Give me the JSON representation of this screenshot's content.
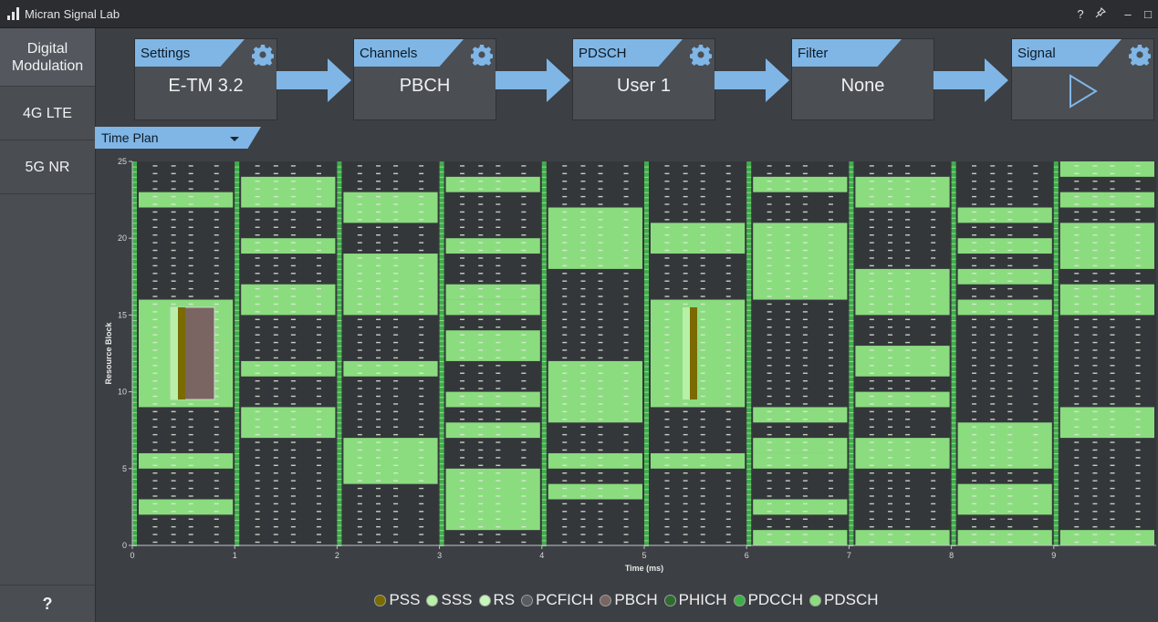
{
  "window": {
    "title": "Micran Signal Lab",
    "controls": {
      "help": "?",
      "pin": "pin-icon",
      "minimize": "–",
      "maximize": "□"
    }
  },
  "sidebar": {
    "items": [
      {
        "label": "Digital\nModulation",
        "active": true
      },
      {
        "label": "4G LTE",
        "active": false
      },
      {
        "label": "5G NR",
        "active": false
      }
    ],
    "help": "?"
  },
  "pipeline": {
    "settings": {
      "label": "Settings",
      "value": "E-TM 3.2"
    },
    "channels": {
      "label": "Channels",
      "value": "PBCH"
    },
    "pdsch": {
      "label": "PDSCH",
      "value": "User 1"
    },
    "filter": {
      "label": "Filter",
      "value": "None"
    },
    "signal": {
      "label": "Signal",
      "icon": "play-icon"
    }
  },
  "timeplan": {
    "dropdown_label": "Time Plan"
  },
  "colors": {
    "accent": "#7fb6e6",
    "PSS": "#7a6a00",
    "SSS": "#b8f0a8",
    "RS": "#c8f5bc",
    "PCFICH": "#5a5c60",
    "PBCH": "#7a6562",
    "PHICH": "#2f6a2e",
    "PDCCH": "#3fae4a",
    "PDSCH": "#8bdc7f"
  },
  "chart_data": {
    "type": "heatmap",
    "xlabel": "Time (ms)",
    "ylabel": "Resource Block",
    "xlim": [
      0,
      10
    ],
    "ylim": [
      0,
      25
    ],
    "x_ticks": [
      "0",
      "1",
      "2",
      "3",
      "4",
      "5",
      "6",
      "7",
      "8",
      "9"
    ],
    "y_ticks": [
      "0",
      "5",
      "10",
      "15",
      "20",
      "25"
    ],
    "pdsch_allocations": [
      {
        "subframe": 0,
        "rb_ranges": [
          [
            2,
            3
          ],
          [
            5,
            6
          ],
          [
            9,
            16
          ],
          [
            22,
            23
          ]
        ]
      },
      {
        "subframe": 1,
        "rb_ranges": [
          [
            7,
            9
          ],
          [
            11,
            12
          ],
          [
            15,
            17
          ],
          [
            19,
            20
          ],
          [
            22,
            24
          ]
        ]
      },
      {
        "subframe": 2,
        "rb_ranges": [
          [
            4,
            7
          ],
          [
            11,
            12
          ],
          [
            15,
            19
          ],
          [
            21,
            23
          ]
        ]
      },
      {
        "subframe": 3,
        "rb_ranges": [
          [
            1,
            5
          ],
          [
            7,
            8
          ],
          [
            9,
            10
          ],
          [
            12,
            14
          ],
          [
            15,
            16
          ],
          [
            16,
            17
          ],
          [
            19,
            20
          ],
          [
            23,
            24
          ]
        ]
      },
      {
        "subframe": 4,
        "rb_ranges": [
          [
            3,
            4
          ],
          [
            5,
            6
          ],
          [
            8,
            12
          ],
          [
            18,
            22
          ]
        ]
      },
      {
        "subframe": 5,
        "rb_ranges": [
          [
            5,
            6
          ],
          [
            9,
            16
          ],
          [
            19,
            21
          ]
        ]
      },
      {
        "subframe": 6,
        "rb_ranges": [
          [
            0,
            1
          ],
          [
            2,
            3
          ],
          [
            5,
            6
          ],
          [
            6,
            7
          ],
          [
            8,
            9
          ],
          [
            16,
            21
          ],
          [
            23,
            24
          ]
        ]
      },
      {
        "subframe": 7,
        "rb_ranges": [
          [
            0,
            1
          ],
          [
            5,
            7
          ],
          [
            9,
            10
          ],
          [
            11,
            13
          ],
          [
            15,
            18
          ],
          [
            22,
            24
          ]
        ]
      },
      {
        "subframe": 8,
        "rb_ranges": [
          [
            0,
            1
          ],
          [
            2,
            4
          ],
          [
            5,
            8
          ],
          [
            17,
            18
          ],
          [
            19,
            20
          ],
          [
            21,
            22
          ],
          [
            15,
            16
          ]
        ]
      },
      {
        "subframe": 9,
        "rb_ranges": [
          [
            0,
            1
          ],
          [
            7,
            9
          ],
          [
            15,
            17
          ],
          [
            18,
            21
          ],
          [
            22,
            23
          ],
          [
            24,
            25
          ]
        ]
      }
    ],
    "pbch_blocks": [
      {
        "subframe": 0,
        "rb_range": [
          9.5,
          15.5
        ],
        "symbols": "0.2-0.8"
      },
      {
        "subframe": 5,
        "rb_range": [
          9.5,
          15.5
        ],
        "symbols": "0.2-0.4"
      }
    ],
    "legend": [
      {
        "name": "PSS",
        "color": "#7a6a00"
      },
      {
        "name": "SSS",
        "color": "#b8f0a8"
      },
      {
        "name": "RS",
        "color": "#c8f5bc"
      },
      {
        "name": "PCFICH",
        "color": "#5a5c60"
      },
      {
        "name": "PBCH",
        "color": "#7a6562"
      },
      {
        "name": "PHICH",
        "color": "#2f6a2e"
      },
      {
        "name": "PDCCH",
        "color": "#3fae4a"
      },
      {
        "name": "PDSCH",
        "color": "#8bdc7f"
      }
    ]
  }
}
